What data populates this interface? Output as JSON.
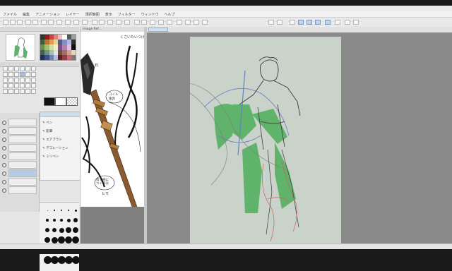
{
  "window": {
    "title": ""
  },
  "menu": {
    "items": [
      "ファイル",
      "編集",
      "アニメーション",
      "レイヤー",
      "選択範囲",
      "表示",
      "フィルター",
      "ウィンドウ",
      "ヘルプ"
    ]
  },
  "reference": {
    "tab_label": "Image Ref...",
    "annotations": [
      "石",
      "コイル\n金具",
      "指で柄に\nつく部分",
      "ヒモ",
      "ヒモ"
    ]
  },
  "subtool": {
    "items": [
      "ペン",
      "鉛筆",
      "エアブラシ",
      "デコレーション",
      "ミリペン"
    ]
  },
  "colors": {
    "figure_fill": "#5fb36b",
    "sketch_line": "#3a3a3a",
    "red_line": "#d06060",
    "blue_line": "#6a7fc0",
    "paper": "#c9d3c9",
    "canvas_bg": "#8a8a8a",
    "accent": "#7a9cc0"
  },
  "palette": [
    "#2c3a2e",
    "#8a2020",
    "#d04040",
    "#e08080",
    "#f0c0c0",
    "#ffffff",
    "#555555",
    "#a0a0a0",
    "#3b5f3b",
    "#c07030",
    "#e0a050",
    "#f0d090",
    "#506080",
    "#8090c0",
    "#b0b8e0",
    "#303030",
    "#6b8f4a",
    "#a0c070",
    "#d0e0a0",
    "#f0f0c0",
    "#805080",
    "#b080b0",
    "#e0c0e0",
    "#101010",
    "#40605a",
    "#70908a",
    "#a0c0b8",
    "#d8e8e0",
    "#705040",
    "#a07060",
    "#d0a090",
    "#e8d0c0",
    "#203050",
    "#405080",
    "#7080b0",
    "#b0c0e0",
    "#602020",
    "#904040",
    "#c07070",
    "#7a7a7a"
  ],
  "icons": [
    "navigator-icon",
    "palette-icon",
    "pen-tool-icon",
    "eraser-icon",
    "layer-icon",
    "brush-dot-icon",
    "eye-icon",
    "lock-icon"
  ]
}
